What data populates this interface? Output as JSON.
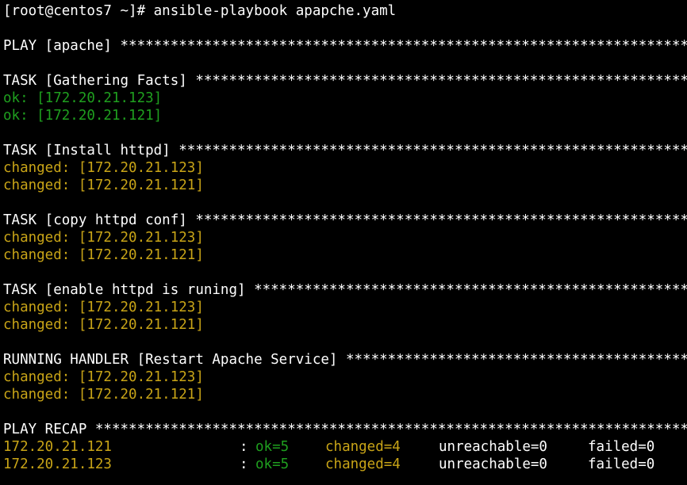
{
  "colors": {
    "background": "#000000",
    "text": "#ffffff",
    "ok": "#1f9f1f",
    "changed": "#c8a417"
  },
  "prompt": "[root@centos7 ~]# ansible-playbook apapche.yaml",
  "play_header": "PLAY [apache] *********************************************************************************************",
  "tasks": [
    {
      "header": "TASK [Gathering Facts] ****************************************************************************",
      "results": [
        {
          "status": "ok",
          "text": "ok: [172.20.21.123]"
        },
        {
          "status": "ok",
          "text": "ok: [172.20.21.121]"
        }
      ]
    },
    {
      "header": "TASK [Install httpd] ******************************************************************************",
      "results": [
        {
          "status": "changed",
          "text": "changed: [172.20.21.123]"
        },
        {
          "status": "changed",
          "text": "changed: [172.20.21.121]"
        }
      ]
    },
    {
      "header": "TASK [copy httpd conf] ****************************************************************************",
      "results": [
        {
          "status": "changed",
          "text": "changed: [172.20.21.123]"
        },
        {
          "status": "changed",
          "text": "changed: [172.20.21.121]"
        }
      ]
    },
    {
      "header": "TASK [enable httpd is runing] *********************************************************************",
      "results": [
        {
          "status": "changed",
          "text": "changed: [172.20.21.123]"
        },
        {
          "status": "changed",
          "text": "changed: [172.20.21.121]"
        }
      ]
    },
    {
      "header": "RUNNING HANDLER [Restart Apache Service] **********************************************************",
      "results": [
        {
          "status": "changed",
          "text": "changed: [172.20.21.123]"
        },
        {
          "status": "changed",
          "text": "changed: [172.20.21.121]"
        }
      ]
    }
  ],
  "recap": {
    "header": "PLAY RECAP ****************************************************************************************",
    "rows": [
      {
        "host": "172.20.21.121",
        "sep": ":",
        "ok": "ok=5",
        "changed": "changed=4",
        "unreachable": "unreachable=0",
        "failed": "failed=0"
      },
      {
        "host": "172.20.21.123",
        "sep": ":",
        "ok": "ok=5",
        "changed": "changed=4",
        "unreachable": "unreachable=0",
        "failed": "failed=0"
      }
    ]
  }
}
